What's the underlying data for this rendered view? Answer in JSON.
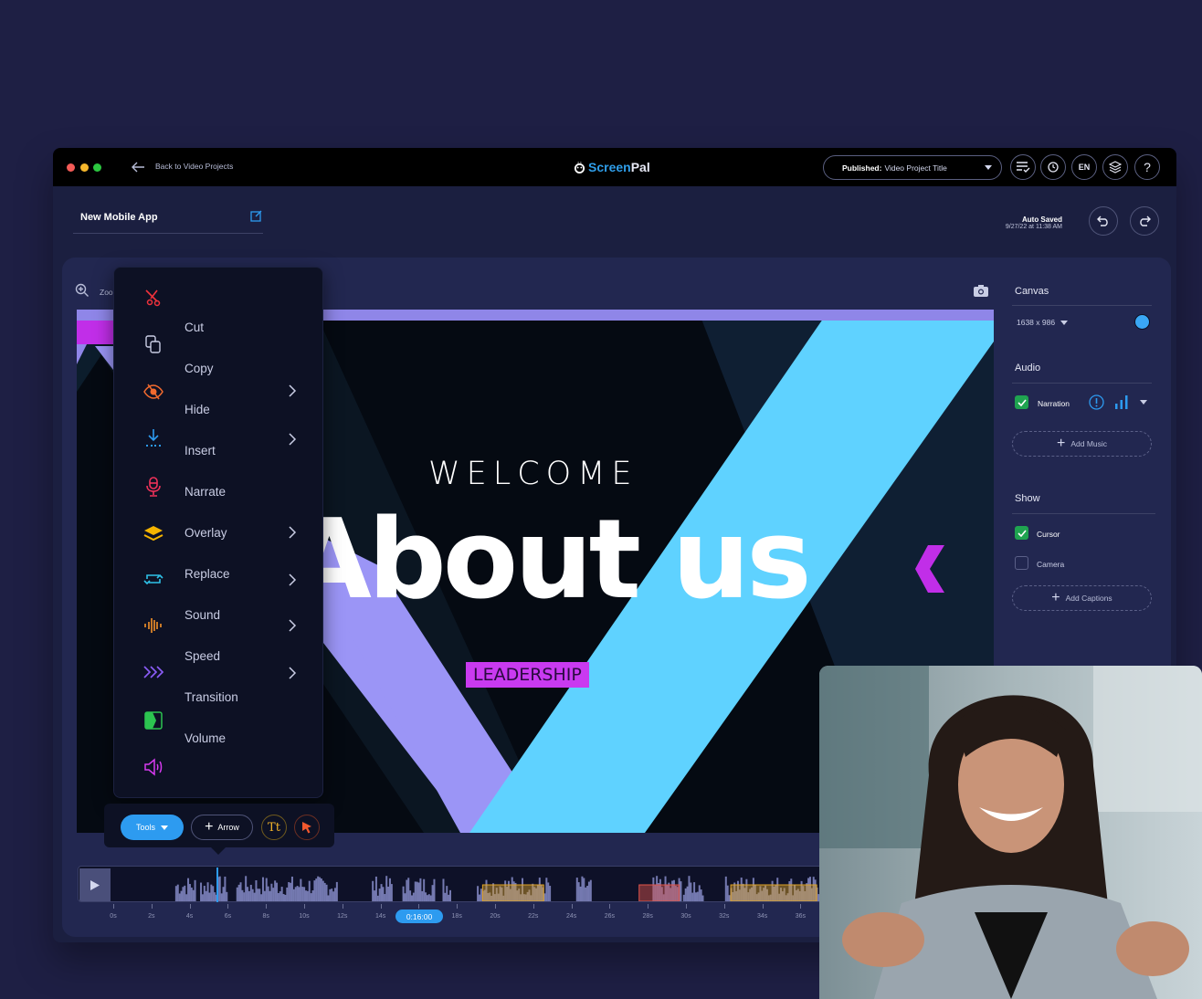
{
  "window": {
    "back_label": "Back to Video Projects",
    "logo_part1": "Screen",
    "logo_part2": "Pal",
    "publish": {
      "prefix": "Published:",
      "value": "Video Project Title"
    },
    "toolbar_icons": [
      "checklist-icon",
      "history-icon",
      "language-button",
      "layers-icon",
      "help-icon"
    ],
    "language": "EN",
    "help": "?"
  },
  "project": {
    "name": "New Mobile App",
    "autosave_title": "Auto Saved",
    "autosave_time": "9/27/22 at 11:38 AM"
  },
  "editor": {
    "zoom_label": "Zoo"
  },
  "stage": {
    "welcome": "WELCOME",
    "headline": "About us",
    "tag": "LEADERSHIP"
  },
  "context_menu": {
    "items": [
      {
        "label": "Cut",
        "icon": "scissors-icon",
        "color": "#f0323c",
        "submenu": false
      },
      {
        "label": "Copy",
        "icon": "copy-icon",
        "color": "#c9cde4",
        "submenu": false
      },
      {
        "label": "Hide",
        "icon": "eye-off-icon",
        "color": "#f26a2e",
        "submenu": true
      },
      {
        "label": "Insert",
        "icon": "insert-icon",
        "color": "#2d9bf0",
        "submenu": true
      },
      {
        "label": "Narrate",
        "icon": "microphone-icon",
        "color": "#f0325a",
        "submenu": false
      },
      {
        "label": "Overlay",
        "icon": "layers-icon",
        "color": "#f5b400",
        "submenu": true
      },
      {
        "label": "Replace",
        "icon": "replace-icon",
        "color": "#2fc2e8",
        "submenu": true
      },
      {
        "label": "Sound",
        "icon": "soundwave-icon",
        "color": "#f5922a",
        "submenu": true
      },
      {
        "label": "Speed",
        "icon": "speed-icon",
        "color": "#8a5cf5",
        "submenu": true
      },
      {
        "label": "Transition",
        "icon": "transition-icon",
        "color": "#2cc450",
        "submenu": false
      },
      {
        "label": "Volume",
        "icon": "volume-icon",
        "color": "#d63af0",
        "submenu": false
      }
    ]
  },
  "tools_bar": {
    "tools_label": "Tools",
    "arrow_label": "Arrow",
    "text_label": "Tt"
  },
  "timeline": {
    "current_time": "0:16:00",
    "tick_labels": [
      "0s",
      "2s",
      "4s",
      "6s",
      "8s",
      "10s",
      "12s",
      "14s",
      "16s",
      "18s",
      "20s",
      "22s",
      "24s",
      "26s",
      "28s",
      "30s",
      "32s",
      "34s",
      "36s"
    ],
    "playhead_seconds": 5.5,
    "segments": [
      {
        "type": "zoom",
        "start": 19.3,
        "end": 22.5,
        "color": "#e0a326"
      },
      {
        "type": "cut",
        "start": 27.5,
        "end": 29.6,
        "color": "#e2554a"
      },
      {
        "type": "zoom",
        "start": 32.3,
        "end": 36.8,
        "color": "#e0a326"
      }
    ]
  },
  "side_panel": {
    "canvas_title": "Canvas",
    "resolution": "1638 x 986",
    "canvas_color": "#3aa7f5",
    "audio_title": "Audio",
    "narration_label": "Narration",
    "narration_checked": true,
    "add_music": "Add Music",
    "show_title": "Show",
    "cursor_label": "Cursor",
    "cursor_checked": true,
    "camera_label": "Camera",
    "camera_checked": false,
    "add_captions": "Add Captions"
  }
}
